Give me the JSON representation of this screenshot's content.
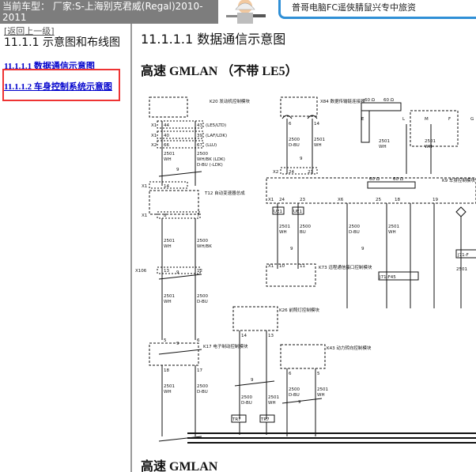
{
  "header": {
    "title": "当前车型：  厂家:S-上海别克君威(Regal)2010-2011",
    "banner_text": "普哥电脑FC遥俠腈鼠兴专中旅资"
  },
  "nav": {
    "back_label": "[返回上一级]",
    "section_heading": "11.1.1 示意图和布线图",
    "links": [
      {
        "label": "11.1.1.1 数据通信示意图"
      },
      {
        "label": "11.1.1.2 车身控制系统示意图"
      }
    ]
  },
  "content": {
    "title": "11.1.1.1 数据通信示意图",
    "subheading_1": "高速 GMLAN （不带 LE5）",
    "subheading_2": "高速 GMLAN"
  },
  "diagram": {
    "modules": {
      "k20": "K20 发动机控制模块",
      "t12": "T12 自动变速器总成",
      "k17": "K17 电子制动控制模块",
      "x84": "X84 数据传输链连接器",
      "k9": "K9 车身控制模块",
      "k73": "K73 远程通信接口控制模块",
      "k26": "K26 前照灯控制模块",
      "k43": "K43 动力转向控制模块"
    },
    "k20_pins": [
      {
        "conn": "X1",
        "l": "44",
        "r": "43",
        "note": "(LE5/LTD)"
      },
      {
        "conn": "X1",
        "l": "40",
        "r": "39",
        "note": "(LAF/LDK)"
      },
      {
        "conn": "X2",
        "l": "66",
        "r": "67",
        "note": "(LLU)"
      }
    ],
    "wires": {
      "w2501": "2501",
      "w2500": "2500",
      "wh": "WH",
      "dbu": "D-BU",
      "wh_bk": "WH/BK",
      "wh_bk_ldk": "WH/BK (LDK)",
      "dbu_ldk": "D-BU (-LDK)",
      "nine": "9",
      "bu": "BU"
    },
    "labels": {
      "x1": "X1",
      "x2": "X2",
      "x6": "X6",
      "x106": "X106",
      "p14": "14",
      "p8": "8",
      "p7": "7",
      "p13": "13",
      "p12": "12",
      "p5": "5",
      "p6": "6",
      "p18": "18",
      "p17": "17",
      "p16": "16",
      "p24": "24",
      "p23": "23",
      "p25": "25",
      "p19": "19",
      "p10": "10",
      "p11": "11",
      "p15": "15",
      "ue1": "UE1",
      "tr7": "TR7",
      "ohm": "60 Ω",
      "e": "E",
      "l": "L",
      "m": "M",
      "f": "F",
      "g": "G",
      "j71f45": "J71-F45",
      "j71f": "J71-F"
    }
  }
}
